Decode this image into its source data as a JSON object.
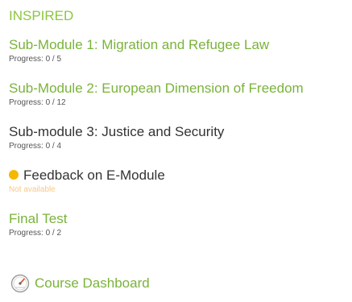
{
  "course": {
    "title": "INSPIRED"
  },
  "items": [
    {
      "label": "Sub-Module 1: Migration and Refugee Law",
      "progress": "Progress: 0 / 5"
    },
    {
      "label": "Sub-Module 2: European Dimension of Freedom",
      "progress": "Progress: 0 / 12"
    },
    {
      "label": "Sub-module 3: Justice and Security",
      "progress": "Progress: 0 / 4"
    },
    {
      "label": "Feedback on E-Module",
      "status": "Not available"
    },
    {
      "label": "Final Test",
      "progress": "Progress: 0 / 2"
    }
  ],
  "dashboard": {
    "label": "Course Dashboard",
    "icon": "gauge-icon"
  },
  "colors": {
    "green": "#7ab33a",
    "title_green": "#8cc63f",
    "dot": "#f5b800",
    "not_available": "#f7c98a"
  }
}
